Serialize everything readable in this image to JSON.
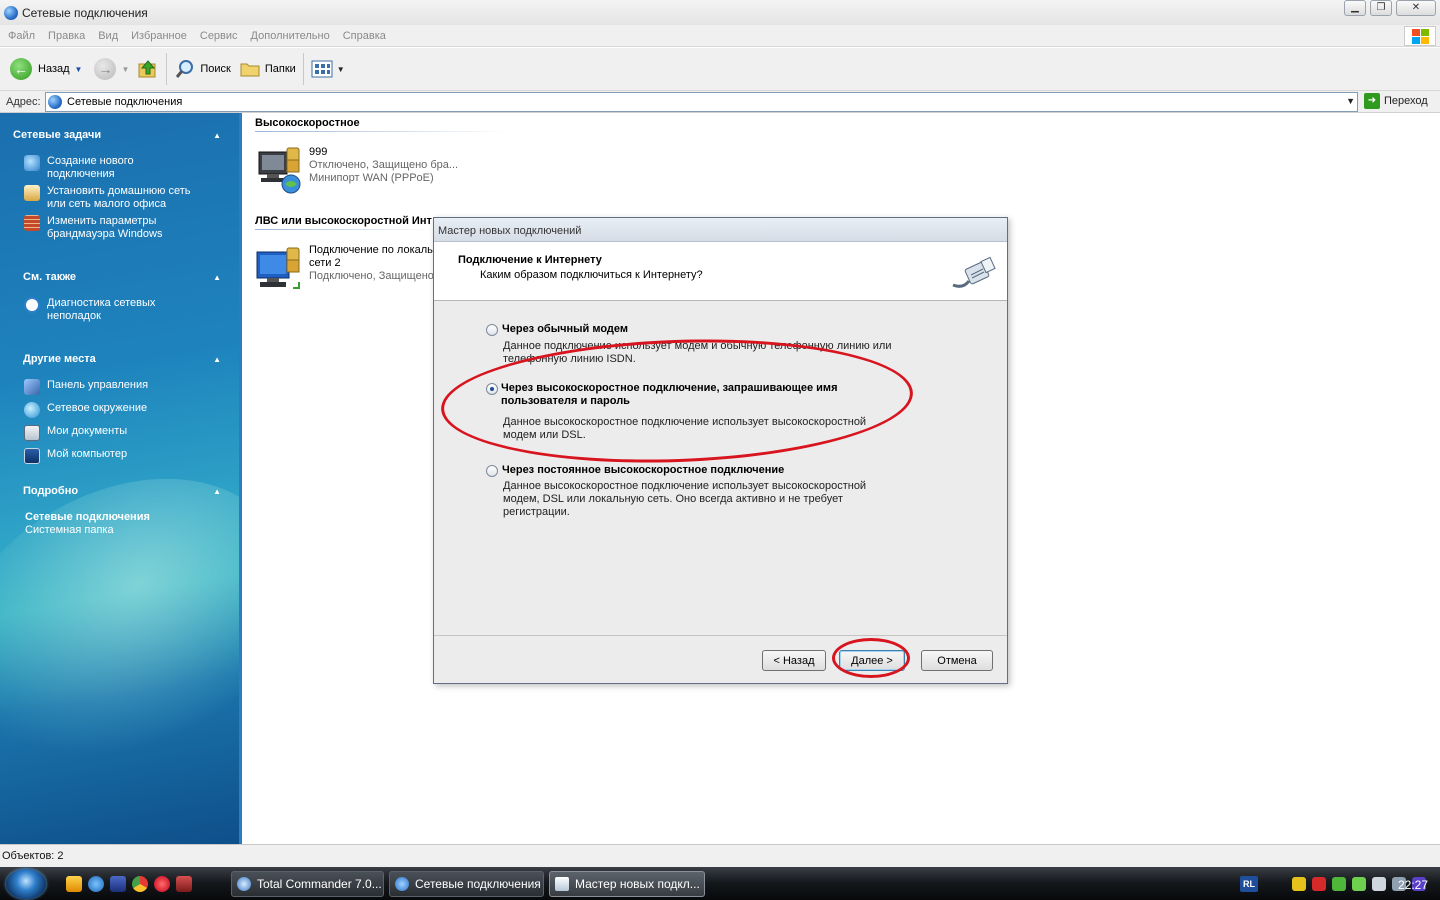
{
  "window": {
    "title": "Сетевые подключения"
  },
  "menu": [
    "Файл",
    "Правка",
    "Вид",
    "Избранное",
    "Сервис",
    "Дополнительно",
    "Справка"
  ],
  "toolbar": {
    "back_label": "Назад",
    "search_label": "Поиск",
    "folders_label": "Папки"
  },
  "address": {
    "label": "Адрес:",
    "value": "Сетевые подключения",
    "go_label": "Переход"
  },
  "sidebar": {
    "network_tasks": {
      "title": "Сетевые задачи",
      "items": [
        {
          "line1": "Создание нового",
          "line2": "подключения",
          "icon": "new-connection-icon"
        },
        {
          "line1": "Установить домашнюю сеть",
          "line2": "или сеть малого офиса",
          "icon": "home-network-icon"
        },
        {
          "line1": "Изменить параметры",
          "line2": "брандмауэра Windows",
          "icon": "firewall-icon"
        }
      ]
    },
    "see_also": {
      "title": "См. также",
      "items": [
        {
          "line1": "Диагностика сетевых",
          "line2": "неполадок",
          "icon": "info-icon"
        }
      ]
    },
    "other_places": {
      "title": "Другие места",
      "items": [
        {
          "label": "Панель управления",
          "icon": "control-panel-icon"
        },
        {
          "label": "Сетевое окружение",
          "icon": "network-places-icon"
        },
        {
          "label": "Мои документы",
          "icon": "my-documents-icon"
        },
        {
          "label": "Мой компьютер",
          "icon": "my-computer-icon"
        }
      ]
    },
    "details": {
      "title": "Подробно",
      "name": "Сетевые подключения",
      "type": "Системная папка"
    }
  },
  "content": {
    "group1": {
      "title": "Высокоскоростное",
      "item": {
        "name": "999",
        "status": "Отключено, Защищено бра...",
        "device": "Минипорт WAN (PPPoE)"
      }
    },
    "group2": {
      "title": "ЛВС или высокоскоростной Инт",
      "item": {
        "name": "Подключение по локаль",
        "name2": "сети 2",
        "status": "Подключено, Защищено"
      }
    }
  },
  "dialog": {
    "title": "Мастер новых подключений",
    "heading": "Подключение к Интернету",
    "subheading": "Каким образом подключиться к Интернету?",
    "options": [
      {
        "label": "Через обычный модем",
        "desc1": "Данное подключение использует модем и обычную телефонную линию или",
        "desc2": "телефонную линию ISDN.",
        "checked": false
      },
      {
        "label1": "Через высокоскоростное подключение, запрашивающее имя",
        "label2": "пользователя и пароль",
        "desc1": "Данное высокоскоростное подключение использует высокоскоростной",
        "desc2": "модем или DSL.",
        "checked": true
      },
      {
        "label": "Через постоянное высокоскоростное подключение",
        "desc1": "Данное высокоскоростное подключение использует высокоскоростной",
        "desc2": "модем, DSL или локальную сеть. Оно всегда активно и не требует",
        "desc3": "регистрации.",
        "checked": false
      }
    ],
    "buttons": {
      "back": "< Назад",
      "next": "Далее >",
      "cancel": "Отмена"
    }
  },
  "status": {
    "text": "Объектов: 2"
  },
  "taskbar": {
    "tasks": [
      {
        "label": "Total Commander 7.0..."
      },
      {
        "label": "Сетевые подключения"
      },
      {
        "label": "Мастер новых подкл..."
      }
    ],
    "lang": "RL",
    "clock": "22:27"
  },
  "colors": {
    "highlight": "#d8141e",
    "sidebar": "#1e83bd",
    "taskbar": "#16191d"
  }
}
